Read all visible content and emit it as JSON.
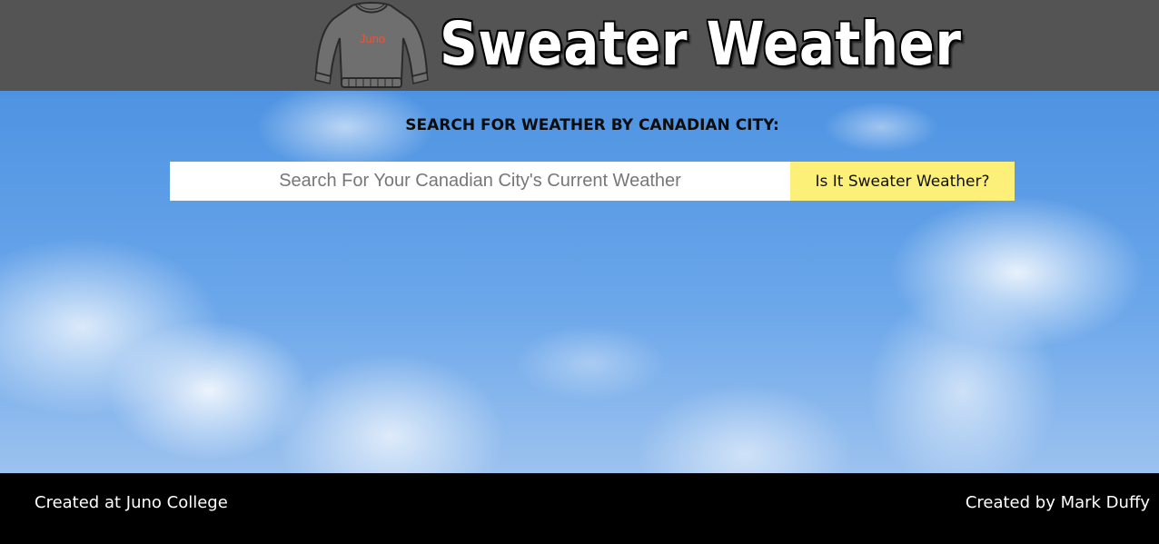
{
  "header": {
    "logo_text": "Juno",
    "title": "Sweater Weather"
  },
  "main": {
    "heading": "SEARCH FOR WEATHER BY CANADIAN CITY:",
    "search": {
      "placeholder": "Search For Your Canadian City's Current Weather",
      "value": ""
    },
    "button_label": "Is It Sweater Weather?",
    "button_color": "#fdf078"
  },
  "footer": {
    "left_text": "Created at Juno College",
    "right_text": "Created by Mark Duffy"
  },
  "colors": {
    "header_bg": "#545454",
    "footer_bg": "#000000",
    "logo_text": "#e8553a"
  }
}
